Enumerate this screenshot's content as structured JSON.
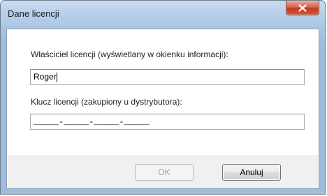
{
  "window": {
    "title": "Dane licencji",
    "close_icon": "close-icon"
  },
  "form": {
    "owner_label": "Właściciel licencji (wyświetlany w okienku informacji):",
    "owner_value": "Roger",
    "key_label": "Klucz licencji (zakupiony u dystrybutora):",
    "key_value": "_____-_____-_____-_____"
  },
  "buttons": {
    "ok_label": "OK",
    "ok_enabled": false,
    "cancel_label": "Anuluj"
  },
  "colors": {
    "close_button": "#c4371f",
    "title_bar": "#b7cfe8",
    "footer": "#f0f0f0"
  }
}
